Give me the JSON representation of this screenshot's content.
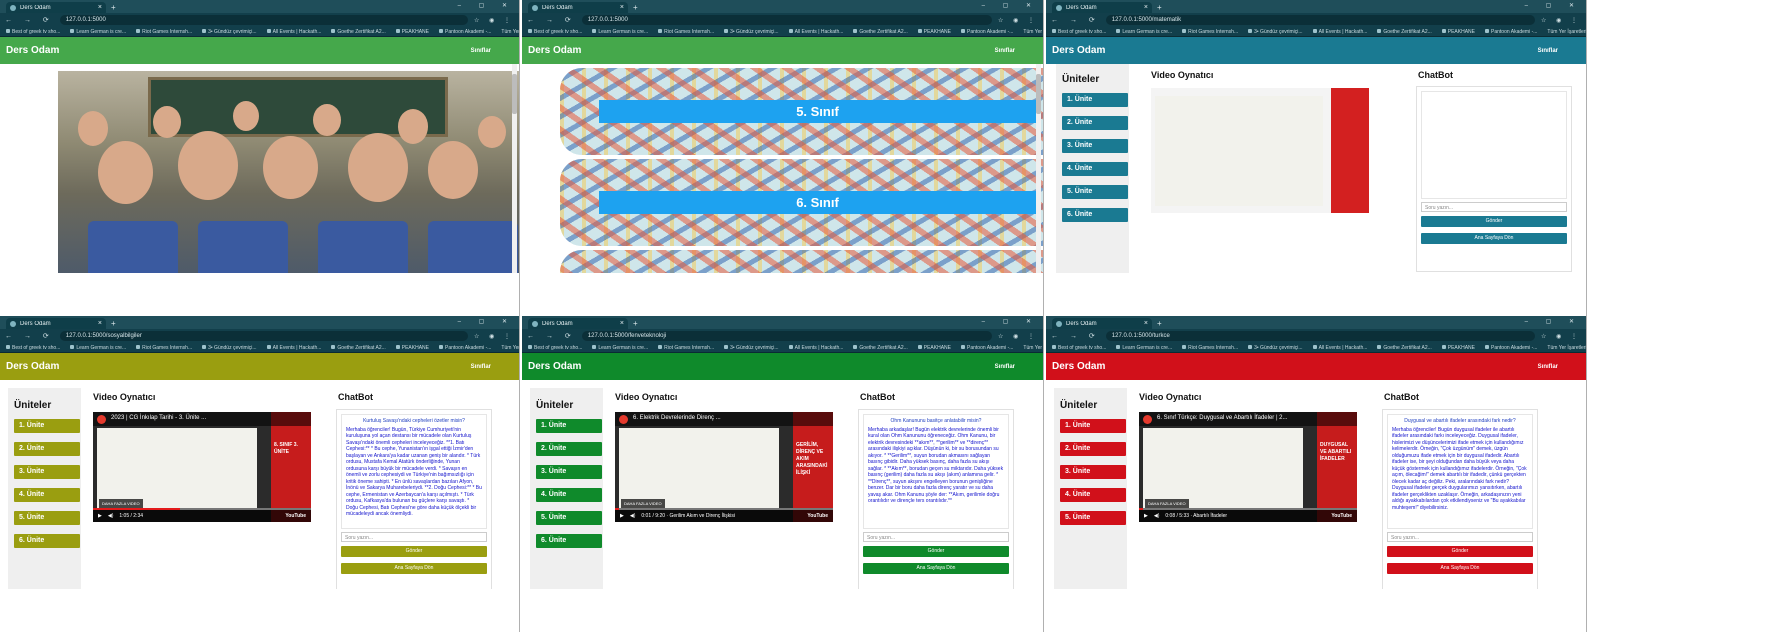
{
  "browser": {
    "tab_title": "Ders Odam",
    "new_tab": "+",
    "window_controls": "– ▢ ✕",
    "nav_icons": "← → ⟳",
    "ext_icons": "☆ ◉ ⋮",
    "all_bookmarks": "Tüm Yer İşaretleri",
    "bookmarks": [
      "Best of greek tv sho...",
      "Learn German is cre...",
      "Riot Games Internsh...",
      "3• Gündüz çevrimiçi...",
      "All Events | Hackath...",
      "Goethe Zertifikat A2...",
      "PEAKHANE",
      "Pantoon Akademi -..."
    ]
  },
  "app": {
    "title": "Ders Odam",
    "classes_link": "Sınıflar"
  },
  "colors": {
    "green": "#45a84b",
    "teal": "#1a7a92",
    "olive": "#9a9e10",
    "darkgreen": "#0f8a2b",
    "red": "#d1101a",
    "card_band": "#1da2f0"
  },
  "windows": [
    {
      "url": "127.0.0.1:5000"
    },
    {
      "url": "127.0.0.1:5000",
      "cards": [
        "5. Sınıf",
        "6. Sınıf"
      ]
    },
    {
      "url": "127.0.0.1:5000/matematik",
      "units": [
        "1. Ünite",
        "2. Ünite",
        "3. Ünite",
        "4. Ünite",
        "5. Ünite",
        "6. Ünite"
      ]
    },
    {
      "url": "127.0.0.1:5000/sosyalbilgiler",
      "units": [
        "1. Ünite",
        "2. Ünite",
        "3. Ünite",
        "4. Ünite",
        "5. Ünite",
        "6. Ünite"
      ],
      "video": {
        "title": "2023 | CG İnkılap Tarihi - 3. Ünite ...",
        "side": "8. SINIF\n3. ÜNİTE",
        "time": "1:05 / 2:34"
      },
      "chat": {
        "question": "Kurtuluş Savaşı'ndaki cepheleri özetler misin?",
        "answer": "Merhaba öğrenciler! Bugün, Türkiye Cumhuriyeti'nin kuruluşuna yol açan destansı bir mücadele olan Kurtuluş Savaşı'ndaki önemli cepheleri inceleyeceğiz. **1. Batı Cephesi:** * Bu cephe, Yunanistan'ın işgal ettiği İzmir'den başlayan ve Ankara'ya kadar uzanan geniş bir alandır. * Türk ordusu, Mustafa Kemal Atatürk önderliğinde, Yunan ordusuna karşı büyük bir mücadele verdi. * Savaşın en önemli ve zorlu cephesiydi ve Türkiye'nin bağımsızlığı için kritik öneme sahipti. * En ünlü savaşlardan bazıları Afyon, İnönü ve Sakarya Muharebeleriydi. **2. Doğu Cephesi:** * Bu cephe, Ermenistan ve Azerbaycan'a karşı açılmıştı. * Türk ordusu, Kafkasya'da bulunan bu güçlere karşı savaştı. * Doğu Cephesi, Batı Cephesi'ne göre daha küçük ölçekli bir mücadeleydi ancak önemliydi."
      }
    },
    {
      "url": "127.0.0.1:5000/fenveteknoloji",
      "units": [
        "1. Ünite",
        "2. Ünite",
        "3. Ünite",
        "4. Ünite",
        "5. Ünite",
        "6. Ünite"
      ],
      "video": {
        "title": "6. Elektrik Devrelerinde Direnç ...",
        "side": "GERİLİM, DİRENÇ VE AKIM ARASINDAKİ İLİŞKİ",
        "time": "0:01 / 9:20 · Gerilim Akım ve Direnç İlişkisi"
      },
      "chat": {
        "question": "Ohm Kanununu basitçe anlatabilir misin?",
        "answer": "Merhaba arkadaşlar! Bugün elektrik devrelerinde önemli bir kural olan Ohm Kanununu öğreneceğiz. Ohm Kanunu, bir elektrik devresindeki **akım**, **gerilim** ve **direnç** arasındaki ilişkiyi açıklar. Düşünün ki, bir su borusundan su akıyor. * **Gerilim**, suyun borudan akmasını sağlayan basınç gibidir. Daha yüksek basınç, daha fazla su akışı sağlar. * **Akım**, borudan geçen su miktarıdır. Daha yüksek basınç (gerilim) daha fazla su akışı (akım) anlamına gelir. * **Direnç**, suyun akışını engelleyen borunun genişliğine benzer. Dar bir boru daha fazla direnç yaratır ve su daha yavaş akar. Ohm Kanunu şöyle der: **Akım, gerilimle doğru orantılıdır ve dirençle ters orantılıdır.**"
      }
    },
    {
      "url": "127.0.0.1:5000/turkce",
      "units": [
        "1. Ünite",
        "2. Ünite",
        "3. Ünite",
        "4. Ünite",
        "5. Ünite"
      ],
      "video": {
        "title": "6. Sınıf Türkçe: Duygusal ve Abartılı İfadeler | 2...",
        "side": "DUYGUSAL VE ABARTILI İFADELER",
        "time": "0:08 / 5:33 · Abartılı İfadeler"
      },
      "chat": {
        "question": "Duygusal ve abartılı ifadeler arasındaki fark nedir?",
        "answer": "Merhaba öğrenciler! Bugün duygusal ifadeler ile abartılı ifadeler arasındaki farkı inceleyeceğiz. Duygusal ifadeler, hislerimizi ve düşüncelerimizi ifade etmek için kullandığımız kelimelerdir. Örneğin, \"Çok üzgünüm\" demek, üzgün olduğumuzu ifade etmek için bir duygusal ifadedir. Abartılı ifadeler ise, bir şeyi olduğundan daha büyük veya daha küçük göstermek için kullandığımız ifadelerdir. Örneğin, \"Çok açım, ölecağim!\" demek abartılı bir ifadedir, çünkü gerçekten ölecek kadar aç değiliz. Peki, aralarındaki fark nedir? Duygusal ifadeler gerçek duygularımızı yansıtırken, abartılı ifadeler gerçeklikten uzaklaşır. Örneğin, arkadaşınızın yeni aldığı ayakkabılardan çok etkilendiyseniz ve \"Bu ayakkabılar muhteşem!\" diyebilirsiniz."
      }
    }
  ],
  "ui": {
    "units_heading": "Üniteler",
    "video_heading": "Video Oynatıcı",
    "chat_heading": "ChatBot",
    "input_placeholder": "Soru yazın...",
    "send": "Gönder",
    "home": "Ana Sayfaya Dön",
    "more_videos": "DAHA FAZLA VIDEO",
    "youtube": "YouTube"
  }
}
